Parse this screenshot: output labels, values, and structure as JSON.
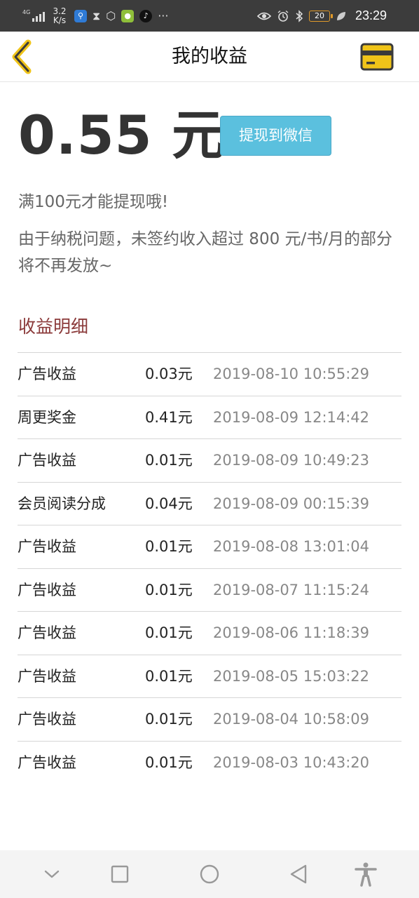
{
  "status_bar": {
    "network": "4G",
    "speed_value": "3.2",
    "speed_unit": "K/s",
    "battery": "20",
    "time": "23:29",
    "more": "···"
  },
  "header": {
    "title": "我的收益"
  },
  "balance": {
    "amount": "0.55 元",
    "withdraw_label": "提现到微信"
  },
  "notice": "满100元才能提现哦!",
  "tax_notice": "由于纳税问题，未签约收入超过 800 元/书/月的部分将不再发放~",
  "detail": {
    "title": "收益明细",
    "rows": [
      {
        "type": "广告收益",
        "amount": "0.03元",
        "time": "2019-08-10 10:55:29"
      },
      {
        "type": "周更奖金",
        "amount": "0.41元",
        "time": "2019-08-09 12:14:42"
      },
      {
        "type": "广告收益",
        "amount": "0.01元",
        "time": "2019-08-09 10:49:23"
      },
      {
        "type": "会员阅读分成",
        "amount": "0.04元",
        "time": "2019-08-09 00:15:39"
      },
      {
        "type": "广告收益",
        "amount": "0.01元",
        "time": "2019-08-08 13:01:04"
      },
      {
        "type": "广告收益",
        "amount": "0.01元",
        "time": "2019-08-07 11:15:24"
      },
      {
        "type": "广告收益",
        "amount": "0.01元",
        "time": "2019-08-06 11:18:39"
      },
      {
        "type": "广告收益",
        "amount": "0.01元",
        "time": "2019-08-05 15:03:22"
      },
      {
        "type": "广告收益",
        "amount": "0.01元",
        "time": "2019-08-04 10:58:09"
      },
      {
        "type": "广告收益",
        "amount": "0.01元",
        "time": "2019-08-03 10:43:20"
      }
    ]
  },
  "colors": {
    "accent_yellow": "#f0c419",
    "withdraw_button": "#5bc0de",
    "section_title": "#8b3a3a"
  },
  "icons": {
    "back": "chevron-left-icon",
    "card": "credit-card-icon",
    "nav": [
      "chevron-down-icon",
      "square-icon",
      "circle-icon",
      "triangle-back-icon",
      "accessibility-icon"
    ]
  }
}
